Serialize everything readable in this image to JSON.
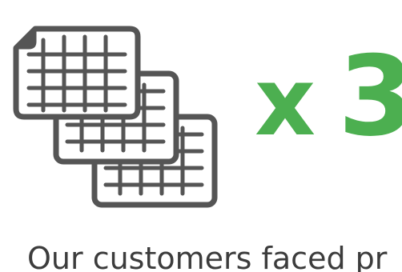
{
  "multiplier": {
    "prefix": "x",
    "value": "3",
    "color": "#4caf50"
  },
  "caption": "Our customers faced pr",
  "icon": {
    "name": "stacked-spreadsheets-icon",
    "count": 3,
    "color": "#555555"
  }
}
